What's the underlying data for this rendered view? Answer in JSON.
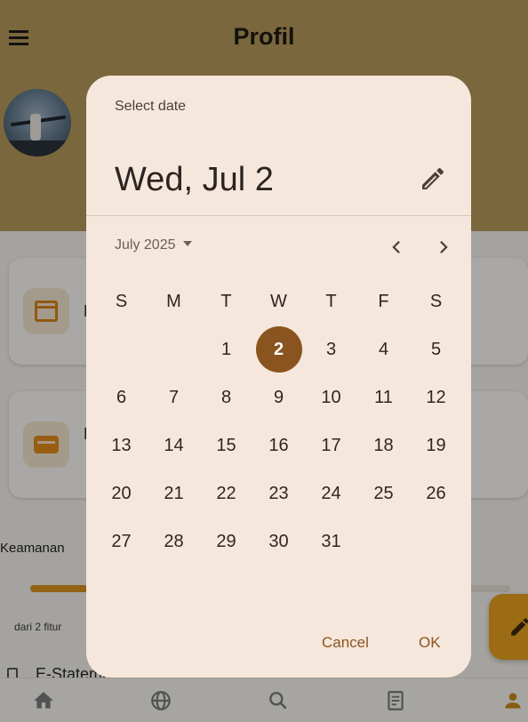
{
  "app": {
    "title": "Profil",
    "card1_letter": "H",
    "card2_letter": "P",
    "section_label": "Keamanan",
    "progress_caption": "dari 2 fitur",
    "progress_fraction": 0.12,
    "estatement_label": "E-Statement"
  },
  "date_picker": {
    "header_label": "Select date",
    "headline": "Wed, Jul 2",
    "month_label": "July 2025",
    "weekdays": [
      "S",
      "M",
      "T",
      "W",
      "T",
      "F",
      "S"
    ],
    "weeks": [
      [
        "",
        "",
        "1",
        "2",
        "3",
        "4",
        "5"
      ],
      [
        "6",
        "7",
        "8",
        "9",
        "10",
        "11",
        "12"
      ],
      [
        "13",
        "14",
        "15",
        "16",
        "17",
        "18",
        "19"
      ],
      [
        "20",
        "21",
        "22",
        "23",
        "24",
        "25",
        "26"
      ],
      [
        "27",
        "28",
        "29",
        "30",
        "31",
        "",
        ""
      ]
    ],
    "selected_day": "2",
    "cancel_label": "Cancel",
    "ok_label": "OK"
  },
  "icons": {
    "menu": "menu-icon",
    "edit": "pencil-icon",
    "prev": "chevron-left-icon",
    "next": "chevron-right-icon",
    "nav": [
      "home-icon",
      "globe-icon",
      "search-icon",
      "receipt-icon",
      "person-icon"
    ]
  },
  "colors": {
    "app_bar": "#b5985a",
    "dialog_surface": "#f6e7dc",
    "primary": "#8a5420",
    "accent": "#e6a020"
  }
}
